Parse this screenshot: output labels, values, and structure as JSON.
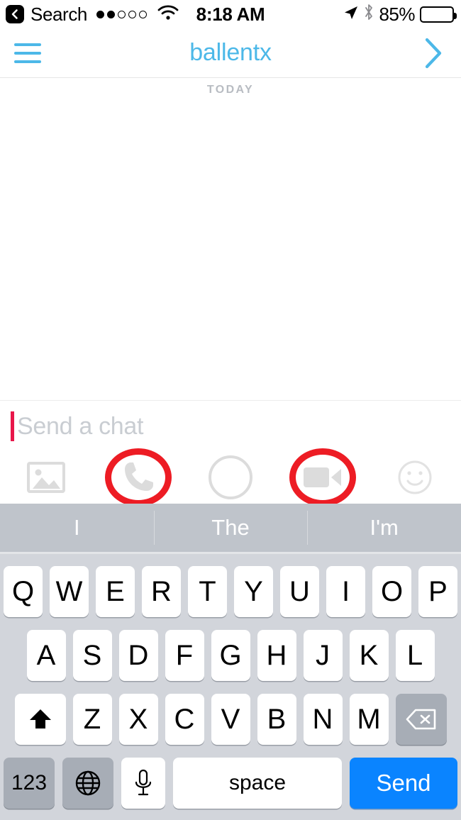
{
  "status_bar": {
    "back_label": "Search",
    "signal_dots": {
      "total": 5,
      "filled": 2
    },
    "wifi_icon": "wifi-icon",
    "time": "8:18 AM",
    "location_icon": "location-arrow-icon",
    "bluetooth_icon": "bluetooth-icon",
    "battery_percent": "85%",
    "battery_level": 85
  },
  "nav_bar": {
    "menu_icon": "hamburger-menu-icon",
    "title": "ballentx",
    "forward_icon": "chevron-right-icon",
    "accent_color": "#4cb8e8"
  },
  "chat": {
    "date_separator": "TODAY",
    "messages": []
  },
  "input_bar": {
    "placeholder": "Send a chat",
    "value": "",
    "caret_color": "#e8174a",
    "actions": [
      {
        "name": "gallery-icon",
        "label": "Gallery",
        "annotated": false
      },
      {
        "name": "phone-call-icon",
        "label": "Voice Call",
        "annotated": true
      },
      {
        "name": "camera-shutter-icon",
        "label": "Camera",
        "annotated": false
      },
      {
        "name": "video-call-icon",
        "label": "Video Call",
        "annotated": true
      },
      {
        "name": "sticker-emoji-icon",
        "label": "Stickers",
        "annotated": false
      }
    ],
    "annotation_color": "#ed1c24"
  },
  "keyboard": {
    "suggestions": [
      "I",
      "The",
      "I'm"
    ],
    "row1": [
      "Q",
      "W",
      "E",
      "R",
      "T",
      "Y",
      "U",
      "I",
      "O",
      "P"
    ],
    "row2": [
      "A",
      "S",
      "D",
      "F",
      "G",
      "H",
      "J",
      "K",
      "L"
    ],
    "row3": [
      "Z",
      "X",
      "C",
      "V",
      "B",
      "N",
      "M"
    ],
    "shift_icon": "shift-arrow-icon",
    "backspace_icon": "backspace-delete-icon",
    "numeric_label": "123",
    "globe_icon": "globe-language-icon",
    "mic_icon": "microphone-icon",
    "space_label": "space",
    "send_label": "Send",
    "send_color": "#0a84ff"
  }
}
